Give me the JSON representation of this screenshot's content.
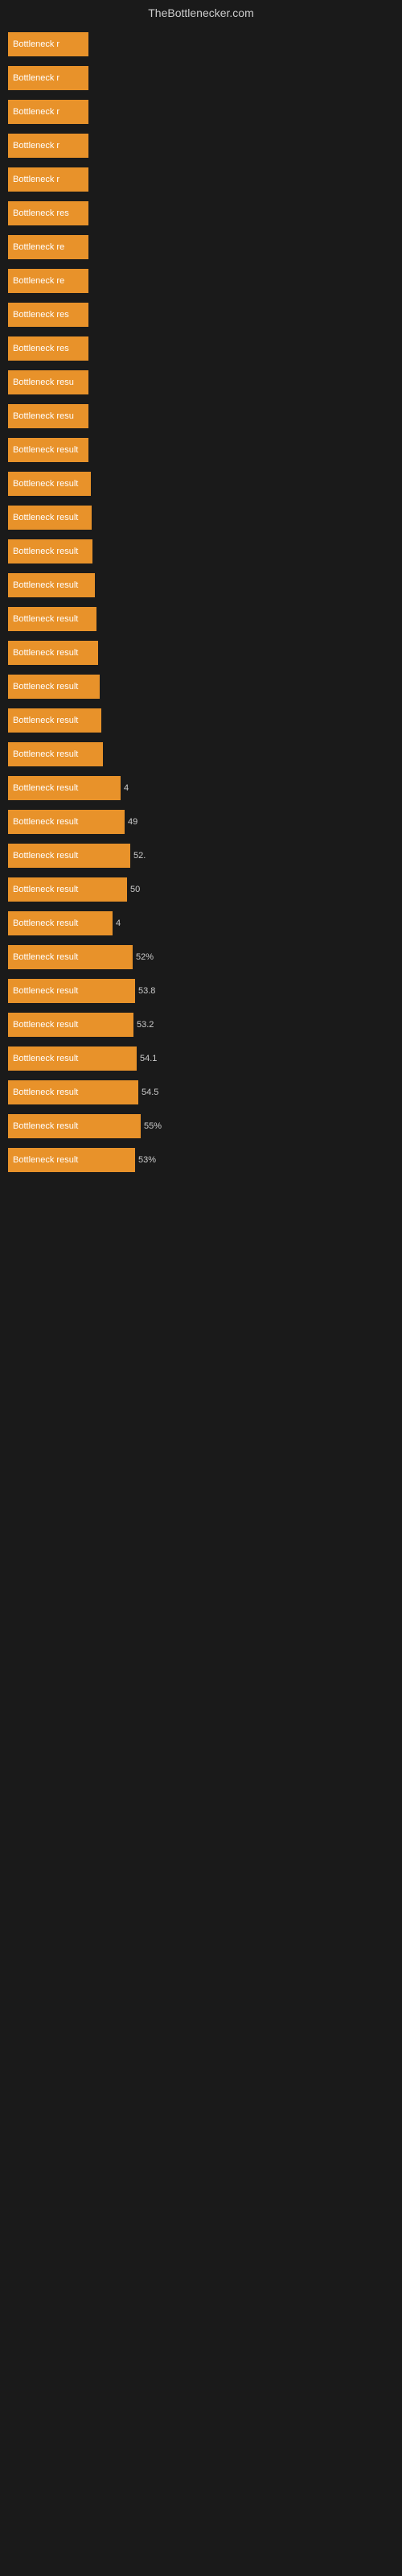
{
  "header": {
    "title": "TheBottlenecker.com"
  },
  "bars": [
    {
      "label": "Bottleneck r",
      "value": "",
      "width": 80
    },
    {
      "label": "Bottleneck r",
      "value": "",
      "width": 82
    },
    {
      "label": "Bottleneck r",
      "value": "",
      "width": 84
    },
    {
      "label": "Bottleneck r",
      "value": "",
      "width": 86
    },
    {
      "label": "Bottleneck r",
      "value": "",
      "width": 88
    },
    {
      "label": "Bottleneck res",
      "value": "",
      "width": 90
    },
    {
      "label": "Bottleneck re",
      "value": "",
      "width": 91
    },
    {
      "label": "Bottleneck re",
      "value": "",
      "width": 92
    },
    {
      "label": "Bottleneck res",
      "value": "",
      "width": 93
    },
    {
      "label": "Bottleneck res",
      "value": "",
      "width": 94
    },
    {
      "label": "Bottleneck resu",
      "value": "",
      "width": 96
    },
    {
      "label": "Bottleneck resu",
      "value": "",
      "width": 97
    },
    {
      "label": "Bottleneck result",
      "value": "",
      "width": 100
    },
    {
      "label": "Bottleneck result",
      "value": "",
      "width": 103
    },
    {
      "label": "Bottleneck result",
      "value": "",
      "width": 104
    },
    {
      "label": "Bottleneck result",
      "value": "",
      "width": 105
    },
    {
      "label": "Bottleneck result",
      "value": "",
      "width": 108
    },
    {
      "label": "Bottleneck result",
      "value": "",
      "width": 110
    },
    {
      "label": "Bottleneck result",
      "value": "",
      "width": 112
    },
    {
      "label": "Bottleneck result",
      "value": "",
      "width": 114
    },
    {
      "label": "Bottleneck result",
      "value": "",
      "width": 116
    },
    {
      "label": "Bottleneck result",
      "value": "",
      "width": 118
    },
    {
      "label": "Bottleneck result",
      "value": "4",
      "width": 140
    },
    {
      "label": "Bottleneck result",
      "value": "49",
      "width": 145
    },
    {
      "label": "Bottleneck result",
      "value": "52.",
      "width": 152
    },
    {
      "label": "Bottleneck result",
      "value": "50",
      "width": 148
    },
    {
      "label": "Bottleneck result",
      "value": "4",
      "width": 130
    },
    {
      "label": "Bottleneck result",
      "value": "52%",
      "width": 155
    },
    {
      "label": "Bottleneck result",
      "value": "53.8",
      "width": 158
    },
    {
      "label": "Bottleneck result",
      "value": "53.2",
      "width": 156
    },
    {
      "label": "Bottleneck result",
      "value": "54.1",
      "width": 160
    },
    {
      "label": "Bottleneck result",
      "value": "54.5",
      "width": 162
    },
    {
      "label": "Bottleneck result",
      "value": "55%",
      "width": 165
    },
    {
      "label": "Bottleneck result",
      "value": "53%",
      "width": 158
    }
  ]
}
